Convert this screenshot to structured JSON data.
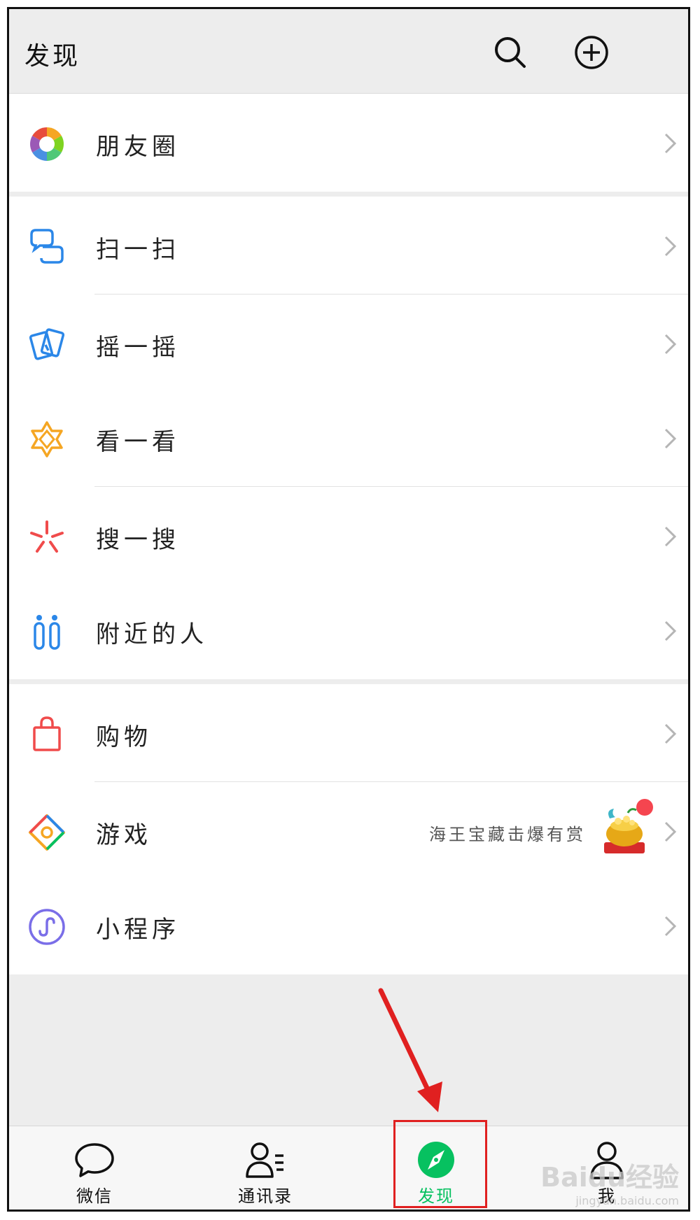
{
  "header": {
    "title": "发现"
  },
  "groups": [
    {
      "items": [
        {
          "label": "朋友圈",
          "icon": "moments-icon"
        }
      ]
    },
    {
      "items": [
        {
          "label": "扫一扫",
          "icon": "scan-icon"
        },
        {
          "label": "摇一摇",
          "icon": "shake-icon"
        }
      ]
    },
    {
      "items": [
        {
          "label": "看一看",
          "icon": "top-stories-icon"
        },
        {
          "label": "搜一搜",
          "icon": "search-star-icon"
        }
      ]
    },
    {
      "items": [
        {
          "label": "附近的人",
          "icon": "people-nearby-icon"
        }
      ]
    },
    {
      "items": [
        {
          "label": "购物",
          "icon": "shopping-bag-icon"
        },
        {
          "label": "游戏",
          "icon": "games-icon",
          "promo": "海王宝藏击爆有赏"
        }
      ]
    },
    {
      "items": [
        {
          "label": "小程序",
          "icon": "mini-programs-icon"
        }
      ]
    }
  ],
  "tabbar": {
    "tabs": [
      {
        "label": "微信",
        "icon": "chat-icon"
      },
      {
        "label": "通讯录",
        "icon": "contacts-icon"
      },
      {
        "label": "发现",
        "icon": "compass-icon",
        "active": true
      },
      {
        "label": "我",
        "icon": "me-icon"
      }
    ]
  },
  "colors": {
    "accent": "#07c160",
    "background": "#ededed",
    "annotation": "#e02020",
    "badge": "#f5454f"
  },
  "watermark": {
    "brand": "Baidu经验",
    "url": "jingyan.baidu.com"
  }
}
